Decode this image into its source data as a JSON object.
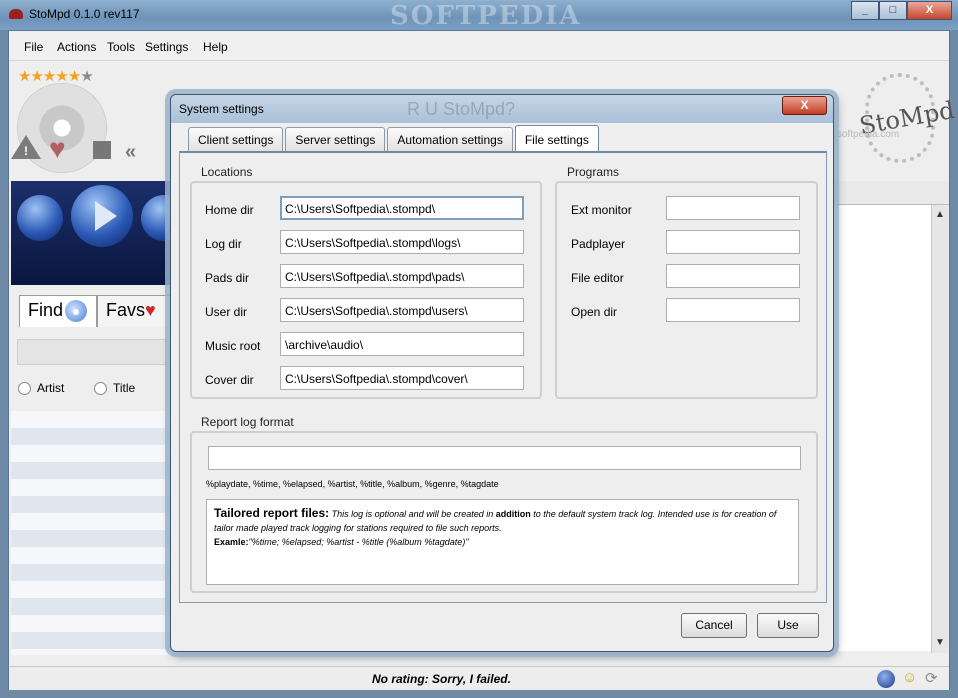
{
  "window": {
    "title": "StoMpd 0.1.0 rev117",
    "watermark": "SOFTPEDIA",
    "min_glyph": "_",
    "max_glyph": "□",
    "close_glyph": "X"
  },
  "menu": [
    "File",
    "Actions",
    "Tools",
    "Settings",
    "Help"
  ],
  "rating": {
    "value": 5,
    "max": 6
  },
  "left_panel": {
    "tabs": {
      "find": "Find",
      "favs": "Favs"
    },
    "radios": [
      "Artist",
      "Title"
    ]
  },
  "logo": {
    "text": "StoMpd",
    "watermark": "www.softpedia.com"
  },
  "statusbar": {
    "message": "No rating: Sorry, I failed."
  },
  "dialog": {
    "title": "System settings",
    "ghost_title": "R U StoMpd?",
    "close_glyph": "X",
    "tabs": [
      "Client settings",
      "Server settings",
      "Automation settings",
      "File settings"
    ],
    "active_tab": "File settings",
    "locations": {
      "title": "Locations",
      "rows": [
        {
          "label": "Home dir",
          "value": "C:\\Users\\Softpedia\\.stompd\\"
        },
        {
          "label": "Log dir",
          "value": "C:\\Users\\Softpedia\\.stompd\\logs\\"
        },
        {
          "label": "Pads dir",
          "value": "C:\\Users\\Softpedia\\.stompd\\pads\\"
        },
        {
          "label": "User dir",
          "value": "C:\\Users\\Softpedia\\.stompd\\users\\"
        },
        {
          "label": "Music root",
          "value": "\\archive\\audio\\"
        },
        {
          "label": "Cover dir",
          "value": "C:\\Users\\Softpedia\\.stompd\\cover\\"
        }
      ]
    },
    "programs": {
      "title": "Programs",
      "rows": [
        {
          "label": "Ext monitor",
          "value": ""
        },
        {
          "label": "Padplayer",
          "value": ""
        },
        {
          "label": "File editor",
          "value": ""
        },
        {
          "label": "Open dir",
          "value": ""
        }
      ]
    },
    "report": {
      "title": "Report log format",
      "format_value": "",
      "tokens": "%playdate, %time, %elapsed, %artist, %title, %album, %genre, %tagdate",
      "info_title": "Tailored report files:",
      "info_part1": " This log is optional and will be created in ",
      "info_bold": "addition",
      "info_part2": " to the default system track log. Intended use is for creation of tailor made played track logging for stations required to file such reports.",
      "example_label": "Examle:",
      "example_value": "\"%time; %elapsed; %artist - %title (%album %tagdate)\""
    },
    "buttons": {
      "cancel": "Cancel",
      "use": "Use"
    }
  }
}
